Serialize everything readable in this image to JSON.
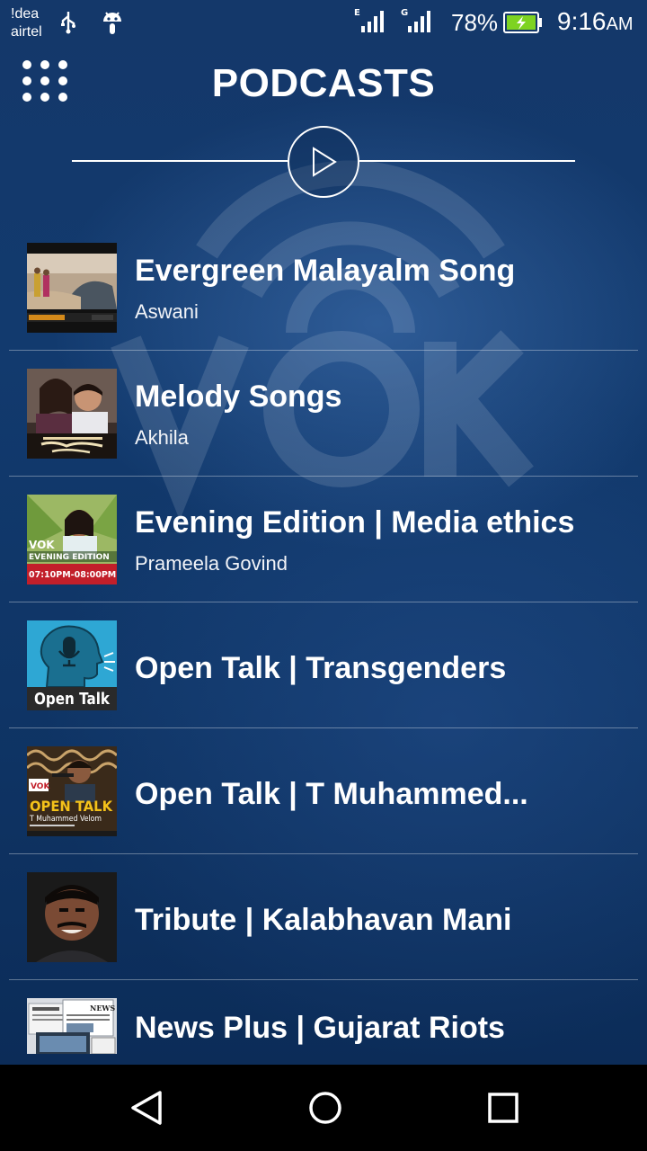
{
  "status_bar": {
    "carrier_line1": "!dea",
    "carrier_line2": "airtel",
    "signal1_label": "E",
    "signal2_label": "G",
    "battery_percent": "78%",
    "time": "9:16",
    "ampm": "AM",
    "icons": [
      "usb-icon",
      "android-debug-icon",
      "signal-icon",
      "signal-icon",
      "battery-charging-icon"
    ]
  },
  "header": {
    "title": "PODCASTS",
    "menu_icon": "grid-dots-icon",
    "play_icon": "play-icon"
  },
  "colors": {
    "background": "#0f3566",
    "text": "#ffffff",
    "battery": "#7ed321"
  },
  "podcasts": [
    {
      "title": "Evergreen Malayalm Song",
      "subtitle": "Aswani"
    },
    {
      "title": "Melody Songs",
      "subtitle": "Akhila"
    },
    {
      "title": "Evening Edition | Media ethics",
      "subtitle": "Prameela Govind"
    },
    {
      "title": "Open Talk | Transgenders",
      "subtitle": ""
    },
    {
      "title": "Open Talk | T Muhammed...",
      "subtitle": ""
    },
    {
      "title": "Tribute | Kalabhavan Mani",
      "subtitle": ""
    },
    {
      "title": "News Plus | Gujarat Riots",
      "subtitle": ""
    }
  ],
  "thumbnails": {
    "evening_edition": {
      "brand": "VOK",
      "line1": "EVENING EDITION",
      "time": "07:10PM-08:00PM"
    },
    "open_talk": {
      "label": "Open Talk"
    },
    "open_talk_2": {
      "brand": "VOK",
      "label": "OPEN TALK",
      "guest": "T Muhammed Velom"
    },
    "news": {
      "label": "NEWS"
    }
  },
  "navigation": {
    "back_icon": "back-triangle-icon",
    "home_icon": "home-circle-icon",
    "recents_icon": "recents-square-icon"
  }
}
